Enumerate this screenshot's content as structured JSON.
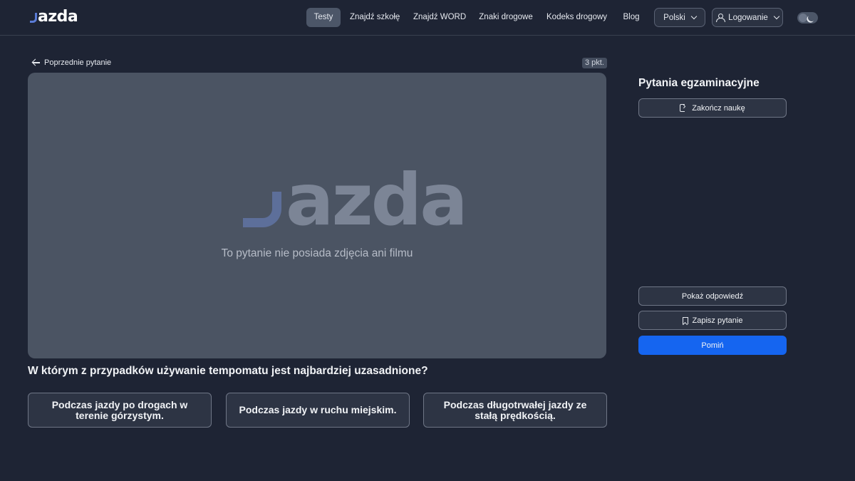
{
  "header": {
    "logo_text": "azda",
    "nav": [
      {
        "label": "Testy",
        "active": true
      },
      {
        "label": "Znajdź szkołę",
        "active": false
      },
      {
        "label": "Znajdź WORD",
        "active": false
      },
      {
        "label": "Znaki drogowe",
        "active": false
      },
      {
        "label": "Kodeks drogowy",
        "active": false
      },
      {
        "label": "Blog",
        "active": false
      }
    ],
    "language": "Polski",
    "login": "Logowanie",
    "theme_toggle_icon": "moon-icon"
  },
  "main": {
    "back_link": "Poprzednie pytanie",
    "points": "3 pkt.",
    "media_logo": "azda",
    "media_placeholder": "To pytanie nie posiada zdjęcia ani filmu",
    "question": "W którym z przypadków używanie tempomatu jest najbardziej uzasadnione?",
    "answers": [
      "Podczas jazdy po drogach w terenie górzystym.",
      "Podczas jazdy w ruchu miejskim.",
      "Podczas długotrwałej jazdy ze stałą prędkością."
    ]
  },
  "sidebar": {
    "title": "Pytania egzaminacyjne",
    "end_label": "Zakończ naukę",
    "show_answer_label": "Pokaż odpowiedź",
    "save_label": "Zapisz pytanie",
    "skip_label": "Pomiń",
    "accent_color": "#1565f0"
  }
}
